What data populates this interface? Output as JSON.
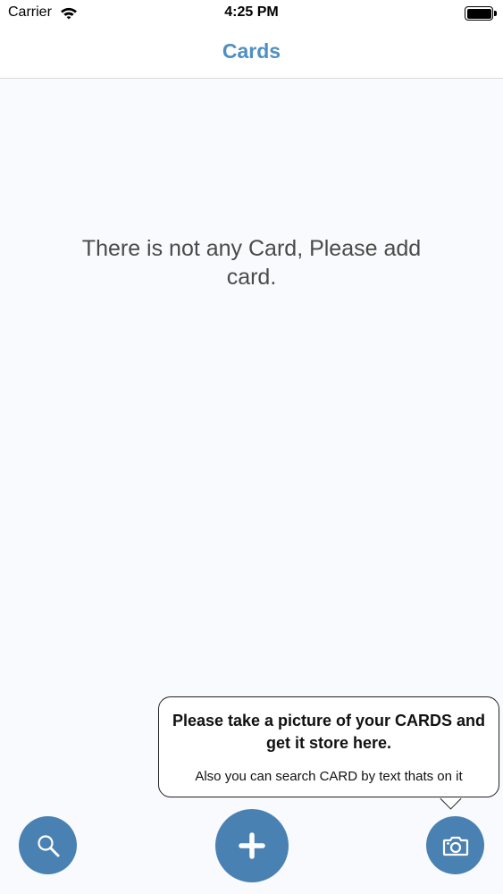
{
  "status_bar": {
    "carrier": "Carrier",
    "time": "4:25 PM"
  },
  "nav": {
    "title": "Cards"
  },
  "empty_state": {
    "message": "There is not any Card, Please add card."
  },
  "tooltip": {
    "title": "Please take a picture of your CARDS and get it store here.",
    "subtitle": "Also you can search CARD by text thats on it"
  },
  "icons": {
    "search": "magnifier-icon",
    "add": "plus-icon",
    "camera": "camera-icon"
  },
  "colors": {
    "accent": "#4d8fc4",
    "fab": "#4a81b3",
    "background": "#f9fafd"
  }
}
